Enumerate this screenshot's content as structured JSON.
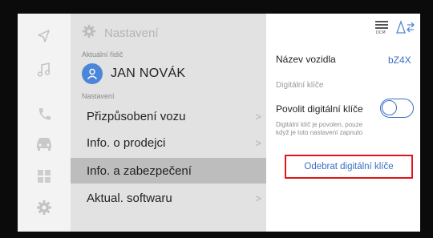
{
  "menu": {
    "header_title": "Nastavení",
    "driver_label": "Aktuální řidič",
    "driver_name": "JAN NOVÁK",
    "section_label": "Nastavení",
    "items": [
      {
        "label": "Přizpůsobení vozu",
        "chevron": ">",
        "active": false
      },
      {
        "label": "Info. o prodejci",
        "chevron": ">",
        "active": false
      },
      {
        "label": "Info. a zabezpečení",
        "chevron": "",
        "active": true
      },
      {
        "label": "Aktual. softwaru",
        "chevron": ">",
        "active": false
      }
    ]
  },
  "rail": {
    "icons": [
      "navigation-arrow-icon",
      "music-note-icon",
      "phone-icon",
      "car-icon",
      "apps-grid-icon",
      "settings-gear-icon"
    ]
  },
  "detail": {
    "vehicle_name_label": "Název vozidla",
    "vehicle_name_value": "bZ4X",
    "section_label": "Digitální klíče",
    "enable_label": "Povolit digitální klíče",
    "toggle_state": "off",
    "note": "Digitální klíč je povolen, pouze když je toto nastavení zapnuto",
    "remove_button": "Odebrat digitální klíče"
  },
  "colors": {
    "accent_blue": "#3a6fc4",
    "highlight_red": "#e2151b",
    "menu_bg": "#e2e2e2",
    "active_item_bg": "#bdbdbd"
  }
}
